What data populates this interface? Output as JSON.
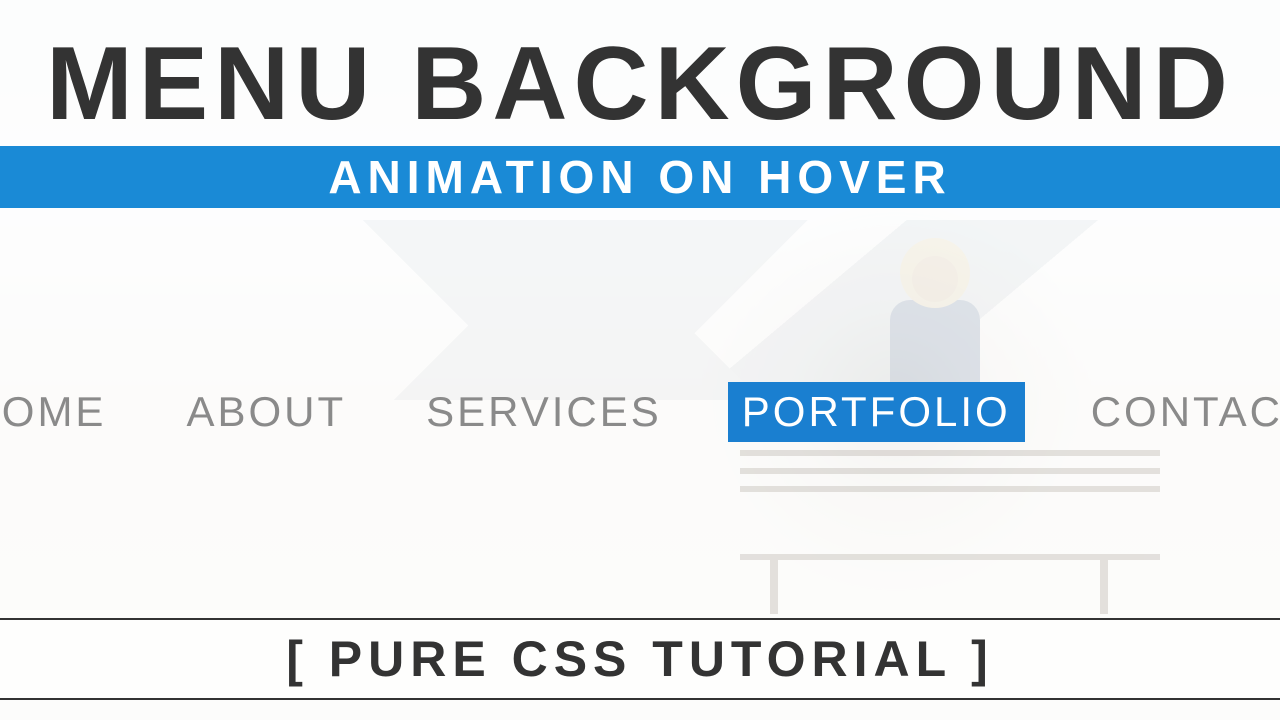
{
  "title": {
    "main": "MENU BACKGROUND",
    "sub": "ANIMATION ON HOVER"
  },
  "menu": {
    "items": [
      {
        "label": "HOME",
        "active": false
      },
      {
        "label": "ABOUT",
        "active": false
      },
      {
        "label": "SERVICES",
        "active": false
      },
      {
        "label": "PORTFOLIO",
        "active": true
      },
      {
        "label": "CONTACT",
        "active": false
      }
    ]
  },
  "footer": {
    "text": "[ PURE CSS TUTORIAL ]"
  },
  "colors": {
    "accent": "#1a8ad6",
    "text_dark": "#333333",
    "text_muted": "#8a8a8a"
  }
}
